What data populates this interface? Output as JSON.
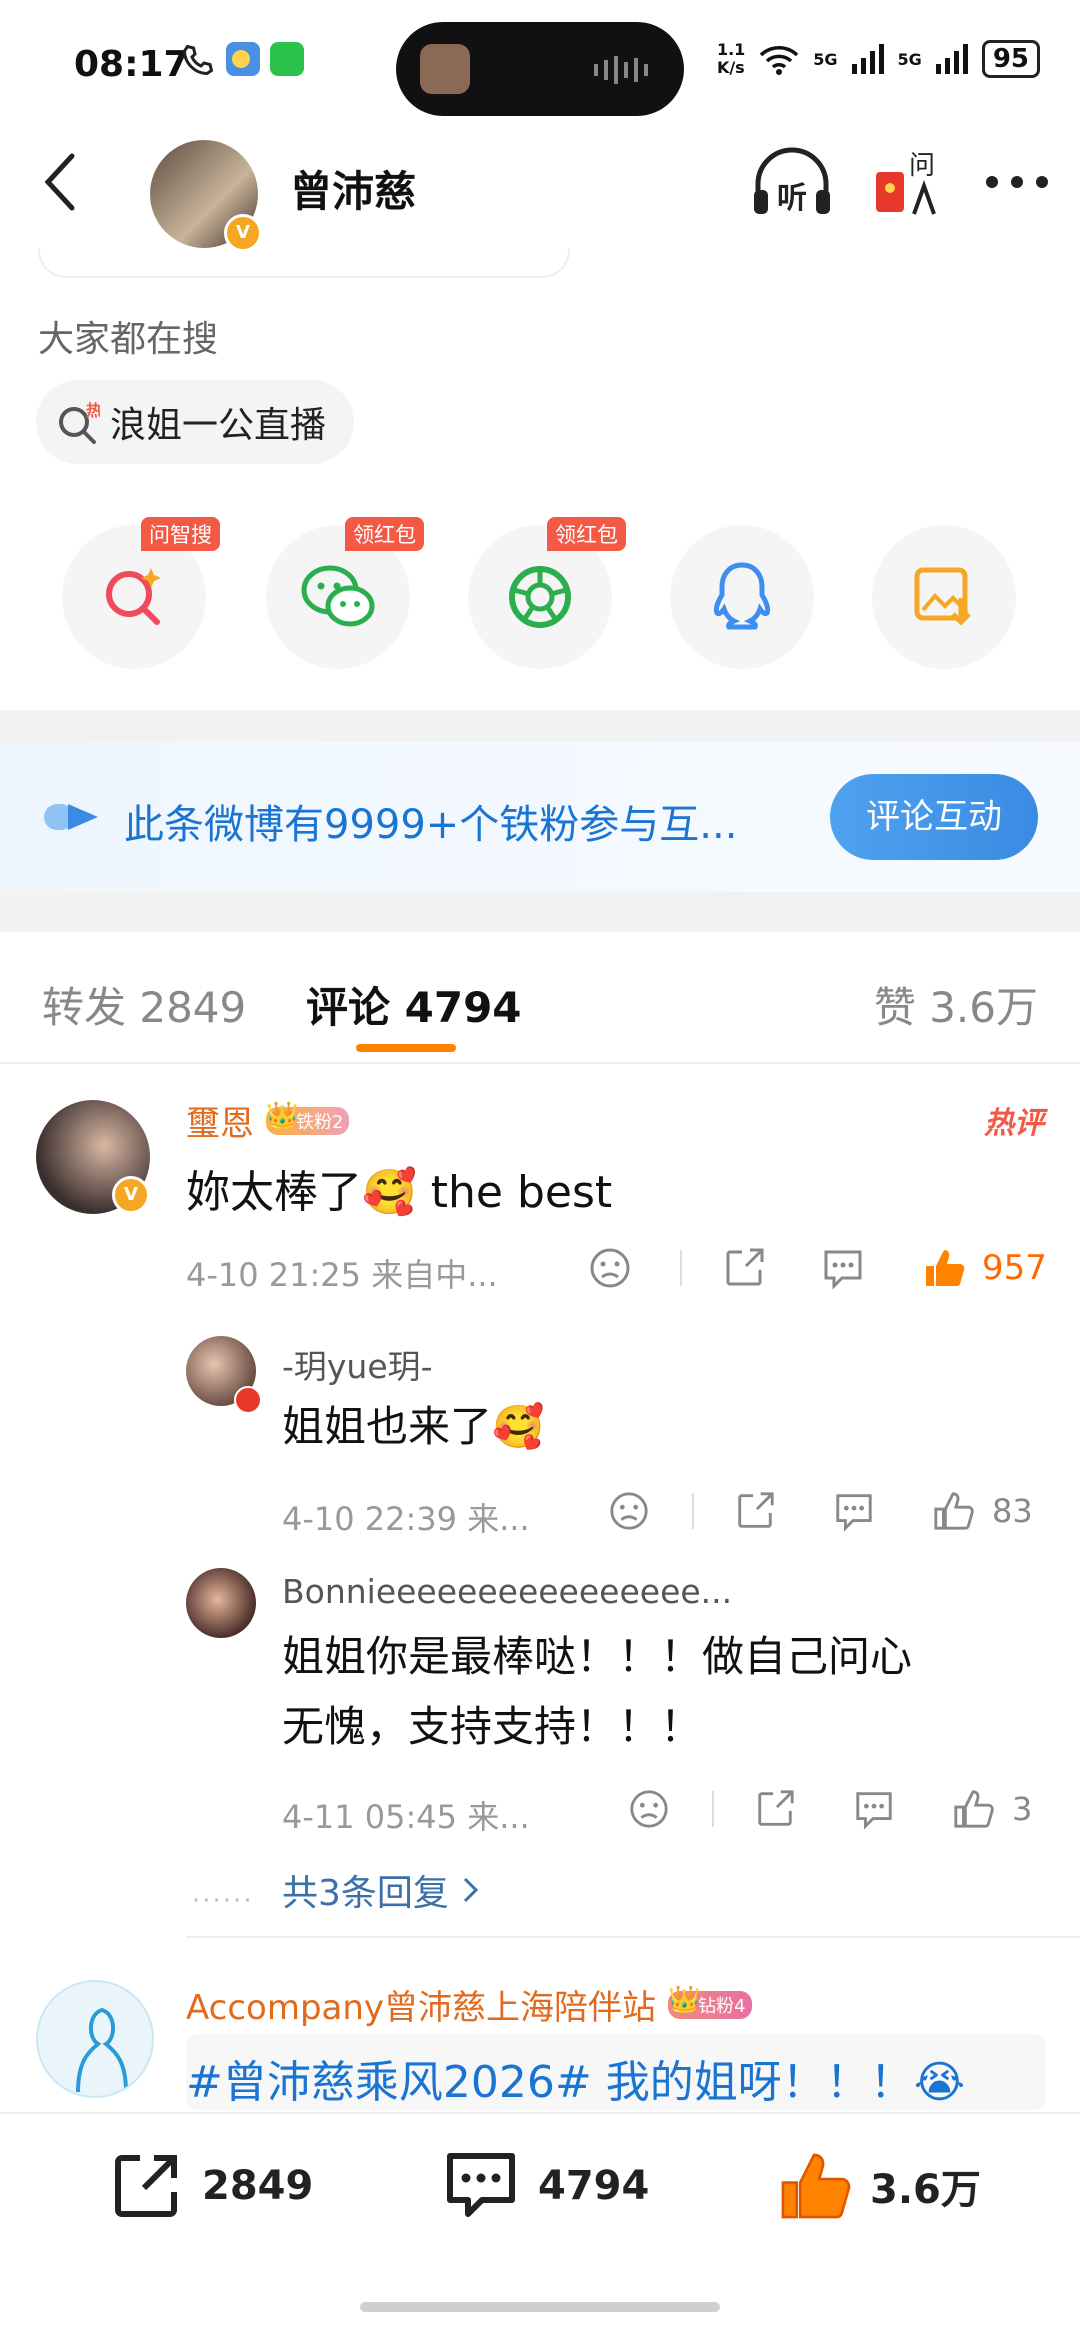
{
  "status_bar": {
    "time": "08:17",
    "net_speed": "1.1\nK/s",
    "sig1": "5G",
    "sig2": "5G",
    "battery": "95"
  },
  "header": {
    "title": "曾沛慈"
  },
  "search": {
    "title": "大家都在搜",
    "chip_label": "浪姐一公直播"
  },
  "share": {
    "items": [
      {
        "name": "wenzhisou",
        "tag": "问智搜",
        "icon": "ai-search-icon"
      },
      {
        "name": "wechat",
        "tag": "领红包",
        "icon": "wechat-icon"
      },
      {
        "name": "moments",
        "tag": "领红包",
        "icon": "moments-icon"
      },
      {
        "name": "qq",
        "tag": "",
        "icon": "qq-icon"
      },
      {
        "name": "save-image",
        "tag": "",
        "icon": "save-image-icon"
      }
    ]
  },
  "fan_banner": {
    "text": "此条微博有9999+个铁粉参与互...",
    "button": "评论互动"
  },
  "tabs": {
    "repost": "转发 2849",
    "comment": "评论 4794",
    "like": "赞 3.6万"
  },
  "comment1": {
    "user": "璽恩",
    "fan_level": "铁粉2",
    "hot_label": "热评",
    "text": "妳太棒了🥰 the best",
    "meta": "4-10 21:25 来自中...",
    "likes": "957"
  },
  "reply1": {
    "user": "-玥yue玥-",
    "text": "姐姐也来了🥰",
    "meta": "4-10 22:39 来...",
    "likes": "83"
  },
  "reply2": {
    "user": "Bonnieeeeeeeeeeeeeeee...",
    "text_line1": "姐姐你是最棒哒！！！做自己问心",
    "text_line2": "无愧，支持支持！！！",
    "meta": "4-11 05:45 来...",
    "likes": "3"
  },
  "more_replies": "共3条回复",
  "comment2": {
    "user": "Accompany曾沛慈上海陪伴站",
    "fan_level": "钻粉4",
    "text": "#曾沛慈乘风2026# 我的姐呀！！！😭"
  },
  "bottom_bar": {
    "repost": "2849",
    "comment": "4794",
    "like": "3.6万"
  },
  "colors": {
    "accent_orange": "#ff8200",
    "link_blue": "#1a74d2",
    "hot_red": "#f25a45"
  }
}
